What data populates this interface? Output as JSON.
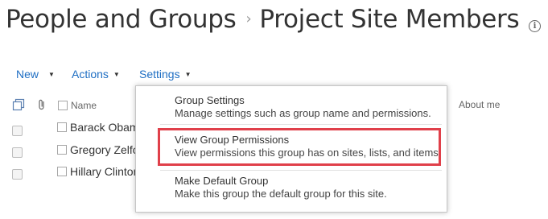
{
  "header": {
    "breadcrumb_root": "People and Groups",
    "separator": "›",
    "page_title": "Project Site Members",
    "info_glyph": "i"
  },
  "toolbar": {
    "new_label": "New",
    "actions_label": "Actions",
    "settings_label": "Settings",
    "caret": "▼"
  },
  "list": {
    "header_name": "Name",
    "header_about": "About me",
    "rows": [
      {
        "name": "Barack Obama"
      },
      {
        "name": "Gregory Zelfo"
      },
      {
        "name": "Hillary Clinton"
      }
    ]
  },
  "settings_menu": {
    "items": [
      {
        "title": "Group Settings",
        "description": "Manage settings such as group name and permissions."
      },
      {
        "title": "View Group Permissions",
        "description": "View permissions this group has on sites, lists, and items."
      },
      {
        "title": "Make Default Group",
        "description": "Make this group the default group for this site."
      }
    ],
    "highlighted_index": 1,
    "highlight_color": "#e0404a"
  },
  "colors": {
    "link": "#1e6ec3",
    "title_text": "#333333"
  }
}
